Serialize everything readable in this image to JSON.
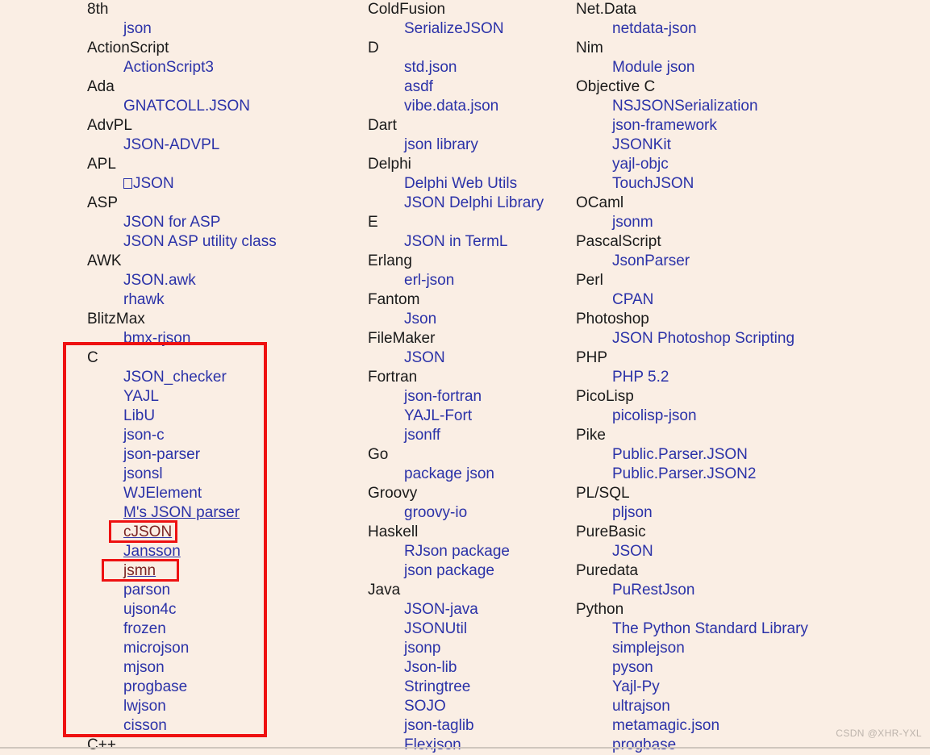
{
  "page": {
    "background_color": "#faeee4",
    "language_color": "#1a1a1a",
    "link_color": "#2b32a8",
    "visited_link_color": "#7a2424",
    "annotation_color": "#ee1111",
    "watermark": "CSDN @XHR-YXL"
  },
  "columns": [
    {
      "id": "column-left",
      "entries": [
        {
          "type": "language",
          "label": "8th"
        },
        {
          "type": "library",
          "label": "json"
        },
        {
          "type": "language",
          "label": "ActionScript"
        },
        {
          "type": "library",
          "label": "ActionScript3"
        },
        {
          "type": "language",
          "label": "Ada"
        },
        {
          "type": "library",
          "label": "GNATCOLL.JSON"
        },
        {
          "type": "language",
          "label": "AdvPL"
        },
        {
          "type": "library",
          "label": "JSON-ADVPL"
        },
        {
          "type": "language",
          "label": "APL"
        },
        {
          "type": "library",
          "label": "JSON",
          "prefix_glyph": "missing-glyph-box"
        },
        {
          "type": "language",
          "label": "ASP"
        },
        {
          "type": "library",
          "label": "JSON for ASP"
        },
        {
          "type": "library",
          "label": "JSON ASP utility class"
        },
        {
          "type": "language",
          "label": "AWK"
        },
        {
          "type": "library",
          "label": "JSON.awk"
        },
        {
          "type": "library",
          "label": "rhawk"
        },
        {
          "type": "language",
          "label": "BlitzMax"
        },
        {
          "type": "library",
          "label": "bmx-rjson"
        },
        {
          "type": "language",
          "label": "C"
        },
        {
          "type": "library",
          "label": "JSON_checker"
        },
        {
          "type": "library",
          "label": "YAJL"
        },
        {
          "type": "library",
          "label": "LibU"
        },
        {
          "type": "library",
          "label": "json-c"
        },
        {
          "type": "library",
          "label": "json-parser"
        },
        {
          "type": "library",
          "label": "jsonsl"
        },
        {
          "type": "library",
          "label": "WJElement"
        },
        {
          "type": "library",
          "label": "M's JSON parser",
          "underlined": true
        },
        {
          "type": "library",
          "label": "cJSON",
          "visited": true,
          "underlined": true,
          "highlighted": true
        },
        {
          "type": "library",
          "label": "Jansson",
          "underlined": true
        },
        {
          "type": "library",
          "label": "jsmn",
          "visited": true,
          "underlined": true,
          "highlighted": true
        },
        {
          "type": "library",
          "label": "parson"
        },
        {
          "type": "library",
          "label": "ujson4c"
        },
        {
          "type": "library",
          "label": "frozen"
        },
        {
          "type": "library",
          "label": "microjson"
        },
        {
          "type": "library",
          "label": "mjson"
        },
        {
          "type": "library",
          "label": "progbase"
        },
        {
          "type": "library",
          "label": "lwjson"
        },
        {
          "type": "library",
          "label": "cisson"
        },
        {
          "type": "language",
          "label": "C++"
        }
      ]
    },
    {
      "id": "column-middle",
      "entries": [
        {
          "type": "language",
          "label": "ColdFusion"
        },
        {
          "type": "library",
          "label": "SerializeJSON"
        },
        {
          "type": "language",
          "label": "D"
        },
        {
          "type": "library",
          "label": "std.json"
        },
        {
          "type": "library",
          "label": "asdf"
        },
        {
          "type": "library",
          "label": "vibe.data.json"
        },
        {
          "type": "language",
          "label": "Dart"
        },
        {
          "type": "library",
          "label": "json library"
        },
        {
          "type": "language",
          "label": "Delphi"
        },
        {
          "type": "library",
          "label": "Delphi Web Utils"
        },
        {
          "type": "library",
          "label": "JSON Delphi Library"
        },
        {
          "type": "language",
          "label": "E"
        },
        {
          "type": "library",
          "label": "JSON in TermL"
        },
        {
          "type": "language",
          "label": "Erlang"
        },
        {
          "type": "library",
          "label": "erl-json"
        },
        {
          "type": "language",
          "label": "Fantom"
        },
        {
          "type": "library",
          "label": "Json"
        },
        {
          "type": "language",
          "label": "FileMaker"
        },
        {
          "type": "library",
          "label": "JSON"
        },
        {
          "type": "language",
          "label": "Fortran"
        },
        {
          "type": "library",
          "label": "json-fortran"
        },
        {
          "type": "library",
          "label": "YAJL-Fort"
        },
        {
          "type": "library",
          "label": "jsonff"
        },
        {
          "type": "language",
          "label": "Go"
        },
        {
          "type": "library",
          "label": "package json"
        },
        {
          "type": "language",
          "label": "Groovy"
        },
        {
          "type": "library",
          "label": "groovy-io"
        },
        {
          "type": "language",
          "label": "Haskell"
        },
        {
          "type": "library",
          "label": "RJson package"
        },
        {
          "type": "library",
          "label": "json package"
        },
        {
          "type": "language",
          "label": "Java"
        },
        {
          "type": "library",
          "label": "JSON-java"
        },
        {
          "type": "library",
          "label": "JSONUtil"
        },
        {
          "type": "library",
          "label": "jsonp"
        },
        {
          "type": "library",
          "label": "Json-lib"
        },
        {
          "type": "library",
          "label": "Stringtree"
        },
        {
          "type": "library",
          "label": "SOJO"
        },
        {
          "type": "library",
          "label": "json-taglib"
        },
        {
          "type": "library",
          "label": "Flexjson"
        }
      ]
    },
    {
      "id": "column-right",
      "entries": [
        {
          "type": "language",
          "label": "Net.Data"
        },
        {
          "type": "library",
          "label": "netdata-json"
        },
        {
          "type": "language",
          "label": "Nim"
        },
        {
          "type": "library",
          "label": "Module json"
        },
        {
          "type": "language",
          "label": "Objective C"
        },
        {
          "type": "library",
          "label": "NSJSONSerialization"
        },
        {
          "type": "library",
          "label": "json-framework"
        },
        {
          "type": "library",
          "label": "JSONKit"
        },
        {
          "type": "library",
          "label": "yajl-objc"
        },
        {
          "type": "library",
          "label": "TouchJSON"
        },
        {
          "type": "language",
          "label": "OCaml"
        },
        {
          "type": "library",
          "label": "jsonm"
        },
        {
          "type": "language",
          "label": "PascalScript"
        },
        {
          "type": "library",
          "label": "JsonParser"
        },
        {
          "type": "language",
          "label": "Perl"
        },
        {
          "type": "library",
          "label": "CPAN"
        },
        {
          "type": "language",
          "label": "Photoshop"
        },
        {
          "type": "library",
          "label": "JSON Photoshop Scripting"
        },
        {
          "type": "language",
          "label": "PHP"
        },
        {
          "type": "library",
          "label": "PHP 5.2"
        },
        {
          "type": "language",
          "label": "PicoLisp"
        },
        {
          "type": "library",
          "label": "picolisp-json"
        },
        {
          "type": "language",
          "label": "Pike"
        },
        {
          "type": "library",
          "label": "Public.Parser.JSON"
        },
        {
          "type": "library",
          "label": "Public.Parser.JSON2"
        },
        {
          "type": "language",
          "label": "PL/SQL"
        },
        {
          "type": "library",
          "label": "pljson"
        },
        {
          "type": "language",
          "label": "PureBasic"
        },
        {
          "type": "library",
          "label": "JSON"
        },
        {
          "type": "language",
          "label": "Puredata"
        },
        {
          "type": "library",
          "label": "PuRestJson"
        },
        {
          "type": "language",
          "label": "Python"
        },
        {
          "type": "library",
          "label": "The Python Standard Library"
        },
        {
          "type": "library",
          "label": "simplejson"
        },
        {
          "type": "library",
          "label": "pyson"
        },
        {
          "type": "library",
          "label": "Yajl-Py"
        },
        {
          "type": "library",
          "label": "ultrajson"
        },
        {
          "type": "library",
          "label": "metamagic.json"
        },
        {
          "type": "library",
          "label": "progbase"
        }
      ]
    }
  ],
  "annotations": [
    {
      "id": "annotation-c-section",
      "shape": "rectangle",
      "target": "C language block"
    },
    {
      "id": "annotation-cjson",
      "shape": "rectangle",
      "target": "cJSON"
    },
    {
      "id": "annotation-jsmn",
      "shape": "rectangle",
      "target": "jsmn"
    }
  ]
}
